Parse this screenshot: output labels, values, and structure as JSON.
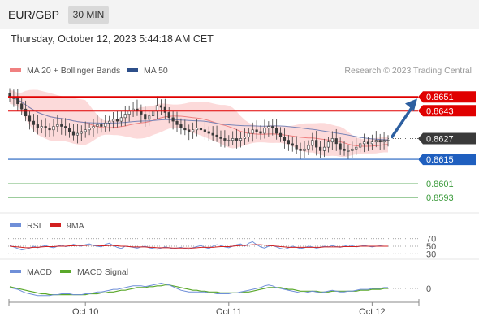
{
  "header": {
    "symbol": "EUR/GBP",
    "timeframe": "30 MIN"
  },
  "datetime": "Thursday, October 12, 2023 5:44:18 AM CET",
  "attribution": "Research © 2023 Trading Central",
  "colors": {
    "candle_up": "#3a3a3a",
    "candle_down": "#3a3a3a",
    "bollinger_fill": "#fbd3d3",
    "ma20": "#f08080",
    "ma50": "#7a86b8",
    "resistance": "#e00000",
    "pivot": "#3a3a3a",
    "support1": "#1f5fbf",
    "support_green": "#3a9a3a",
    "arrow": "#2d5fa0",
    "rsi": "#6f8fd8",
    "rsi_ma": "#d22020",
    "macd": "#6f8fd8",
    "macd_signal": "#5aa82a"
  },
  "chart_data": [
    {
      "type": "candlestick",
      "legend": [
        {
          "name": "MA 20 + Bollinger Bands",
          "color": "#f08080"
        },
        {
          "name": "MA 50",
          "color": "#2d4f8a"
        }
      ],
      "ylim": [
        0.8586,
        0.866
      ],
      "x_ticks": [
        {
          "label": "Oct 10",
          "index": 19
        },
        {
          "label": "Oct 11",
          "index": 55
        },
        {
          "label": "Oct 12",
          "index": 91
        }
      ],
      "current_price": "0.8627",
      "levels": [
        {
          "label": "0.8651",
          "value": 0.8651,
          "kind": "resistance"
        },
        {
          "label": "0.8643",
          "value": 0.8643,
          "kind": "resistance"
        },
        {
          "label": "0.8627",
          "value": 0.8627,
          "kind": "pivot"
        },
        {
          "label": "0.8615",
          "value": 0.8615,
          "kind": "support"
        },
        {
          "label": "0.8601",
          "value": 0.8601,
          "kind": "minor"
        },
        {
          "label": "0.8593",
          "value": 0.8593,
          "kind": "minor"
        }
      ],
      "closes": [
        0.8651,
        0.865,
        0.8647,
        0.8644,
        0.864,
        0.8637,
        0.8635,
        0.8633,
        0.8634,
        0.8633,
        0.8632,
        0.8634,
        0.8635,
        0.8634,
        0.8633,
        0.8631,
        0.8629,
        0.863,
        0.8631,
        0.8632,
        0.8633,
        0.8634,
        0.8635,
        0.8634,
        0.8636,
        0.8637,
        0.8638,
        0.8637,
        0.8639,
        0.8641,
        0.8643,
        0.8644,
        0.8643,
        0.8641,
        0.8638,
        0.864,
        0.8643,
        0.8646,
        0.8645,
        0.8642,
        0.8639,
        0.8637,
        0.8635,
        0.8633,
        0.8632,
        0.8631,
        0.8632,
        0.8633,
        0.8632,
        0.8631,
        0.863,
        0.8629,
        0.8628,
        0.8627,
        0.8626,
        0.8626,
        0.8627,
        0.8626,
        0.8627,
        0.8628,
        0.863,
        0.8632,
        0.8631,
        0.863,
        0.8633,
        0.8634,
        0.8633,
        0.863,
        0.8628,
        0.8626,
        0.8624,
        0.8623,
        0.8621,
        0.862,
        0.8621,
        0.8623,
        0.8626,
        0.8622,
        0.862,
        0.8622,
        0.8625,
        0.8627,
        0.8624,
        0.8621,
        0.862,
        0.862,
        0.8621,
        0.8622,
        0.8624,
        0.8625,
        0.8624,
        0.8625,
        0.8626,
        0.8625,
        0.8626,
        0.8626
      ]
    },
    {
      "type": "line",
      "legend": [
        {
          "name": "RSI",
          "color": "#6f8fd8"
        },
        {
          "name": "9MA",
          "color": "#d22020"
        }
      ],
      "ylim": [
        22,
        78
      ],
      "y_ticks": [
        "70",
        "50",
        "30"
      ],
      "rsi": [
        52,
        48,
        44,
        40,
        42,
        45,
        50,
        46,
        49,
        52,
        48,
        46,
        50,
        53,
        49,
        51,
        55,
        52,
        50,
        54,
        56,
        52,
        50,
        48,
        55,
        58,
        52,
        47,
        44,
        50,
        49,
        47,
        45,
        48,
        50,
        46,
        44,
        42,
        45,
        48,
        46,
        43,
        45,
        47,
        44,
        42,
        46,
        49,
        52,
        47,
        44,
        50,
        54,
        52,
        48,
        46,
        50,
        54,
        56,
        50,
        58,
        62,
        54,
        48,
        45,
        50,
        52,
        48,
        44,
        42,
        46,
        50,
        47,
        44,
        46,
        50,
        48,
        45,
        47,
        50,
        48,
        52,
        49,
        47,
        50,
        53,
        51,
        48,
        50,
        52,
        50,
        48,
        50,
        51,
        50,
        50
      ],
      "ma9": [
        50,
        49,
        48,
        47,
        46,
        46,
        47,
        47,
        48,
        49,
        49,
        49,
        50,
        50,
        50,
        51,
        51,
        52,
        52,
        52,
        53,
        53,
        52,
        51,
        51,
        52,
        52,
        51,
        50,
        50,
        49,
        48,
        48,
        48,
        48,
        47,
        47,
        46,
        46,
        46,
        46,
        45,
        45,
        45,
        45,
        45,
        45,
        46,
        47,
        47,
        47,
        47,
        48,
        49,
        49,
        49,
        50,
        51,
        52,
        52,
        53,
        54,
        54,
        54,
        53,
        52,
        51,
        50,
        49,
        48,
        47,
        47,
        47,
        47,
        47,
        47,
        47,
        47,
        47,
        48,
        48,
        48,
        48,
        48,
        49,
        49,
        49,
        49,
        50,
        50,
        50,
        50,
        50,
        50,
        50,
        50
      ]
    },
    {
      "type": "line",
      "legend": [
        {
          "name": "MACD",
          "color": "#6f8fd8"
        },
        {
          "name": "MACD Signal",
          "color": "#5aa82a"
        }
      ],
      "ylim": [
        -0.0012,
        0.0012
      ],
      "y_ticks": [
        "0"
      ],
      "macd": [
        0.0001,
        0.0,
        -0.0001,
        -0.0003,
        -0.0005,
        -0.0006,
        -0.0007,
        -0.0008,
        -0.0008,
        -0.0008,
        -0.0008,
        -0.0007,
        -0.0007,
        -0.0006,
        -0.0006,
        -0.0006,
        -0.0007,
        -0.0007,
        -0.0007,
        -0.0006,
        -0.0006,
        -0.0005,
        -0.0004,
        -0.0004,
        -0.0003,
        -0.0002,
        -0.0001,
        -0.0001,
        0.0,
        0.0001,
        0.0002,
        0.0003,
        0.0003,
        0.0003,
        0.0002,
        0.0003,
        0.0004,
        0.0005,
        0.0006,
        0.0005,
        0.0004,
        0.0002,
        0.0,
        -0.0002,
        -0.0003,
        -0.0004,
        -0.0004,
        -0.0004,
        -0.0004,
        -0.0004,
        -0.0005,
        -0.0005,
        -0.0006,
        -0.0006,
        -0.0006,
        -0.0006,
        -0.0005,
        -0.0005,
        -0.0004,
        -0.0003,
        -0.0002,
        -0.0001,
        0.0,
        0.0001,
        0.0003,
        0.0004,
        0.0003,
        0.0001,
        0.0,
        -0.0001,
        -0.0002,
        -0.0003,
        -0.0004,
        -0.0005,
        -0.0005,
        -0.0004,
        -0.0003,
        -0.0004,
        -0.0005,
        -0.0004,
        -0.0003,
        -0.0002,
        -0.0003,
        -0.0004,
        -0.0004,
        -0.0003,
        -0.0003,
        -0.0002,
        -0.0001,
        -0.0001,
        -0.0001,
        0.0,
        0.0,
        0.0,
        0.0001,
        0.0001
      ],
      "signal": [
        0.0002,
        0.0001,
        0.0,
        -0.0001,
        -0.0002,
        -0.0003,
        -0.0004,
        -0.0005,
        -0.0006,
        -0.0006,
        -0.0007,
        -0.0007,
        -0.0007,
        -0.0007,
        -0.0007,
        -0.0007,
        -0.0007,
        -0.0007,
        -0.0007,
        -0.0007,
        -0.0006,
        -0.0006,
        -0.0006,
        -0.0005,
        -0.0005,
        -0.0004,
        -0.0004,
        -0.0003,
        -0.0002,
        -0.0002,
        -0.0001,
        0.0,
        0.0001,
        0.0001,
        0.0001,
        0.0002,
        0.0002,
        0.0003,
        0.0003,
        0.0004,
        0.0004,
        0.0003,
        0.0002,
        0.0001,
        0.0,
        -0.0001,
        -0.0002,
        -0.0002,
        -0.0003,
        -0.0003,
        -0.0004,
        -0.0004,
        -0.0004,
        -0.0005,
        -0.0005,
        -0.0005,
        -0.0005,
        -0.0005,
        -0.0005,
        -0.0004,
        -0.0004,
        -0.0003,
        -0.0002,
        -0.0001,
        0.0,
        0.0001,
        0.0001,
        0.0001,
        0.0001,
        0.0,
        -0.0001,
        -0.0001,
        -0.0002,
        -0.0003,
        -0.0003,
        -0.0003,
        -0.0003,
        -0.0003,
        -0.0004,
        -0.0004,
        -0.0004,
        -0.0003,
        -0.0003,
        -0.0003,
        -0.0003,
        -0.0003,
        -0.0003,
        -0.0003,
        -0.0002,
        -0.0002,
        -0.0002,
        -0.0001,
        -0.0001,
        -0.0001,
        0.0,
        0.0
      ]
    }
  ]
}
